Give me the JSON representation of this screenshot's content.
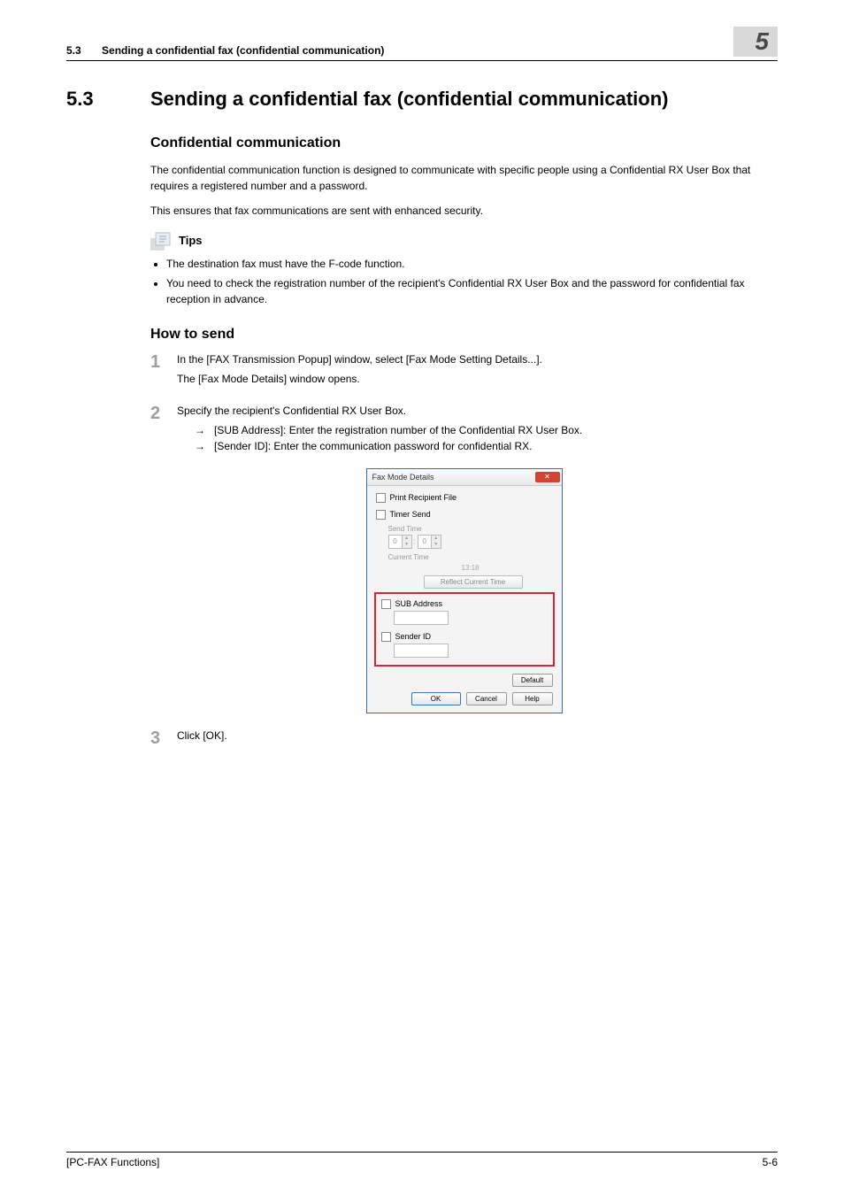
{
  "header": {
    "section_number": "5.3",
    "section_title_short": "Sending a confidential fax (confidential communication)",
    "chapter_number": "5"
  },
  "title": {
    "number": "5.3",
    "text": "Sending a confidential fax (confidential communication)"
  },
  "sub1": {
    "heading": "Confidential communication",
    "p1": "The confidential communication function is designed to communicate with specific people using a Confidential RX User Box that requires a registered number and a password.",
    "p2": "This ensures that fax communications are sent with enhanced security."
  },
  "tips": {
    "label": "Tips",
    "items": [
      "The destination fax must have the F-code function.",
      "You need to check the registration number of the recipient's Confidential RX User Box and the password for confidential fax reception in advance."
    ]
  },
  "sub2": {
    "heading": "How to send",
    "steps": {
      "s1": {
        "num": "1",
        "l1": "In the [FAX Transmission Popup] window, select [Fax Mode Setting Details...].",
        "l2": "The [Fax Mode Details] window opens."
      },
      "s2": {
        "num": "2",
        "l1": "Specify the recipient's Confidential RX User Box.",
        "sub": [
          "[SUB Address]: Enter the registration number of the Confidential RX User Box.",
          "[Sender ID]: Enter the communication password for confidential RX."
        ]
      },
      "s3": {
        "num": "3",
        "l1": "Click [OK]."
      }
    }
  },
  "dialog": {
    "title": "Fax Mode Details",
    "print_recipient": "Print Recipient File",
    "timer_send": "Timer Send",
    "send_time": "Send Time",
    "h": "0",
    "m": "0",
    "current_time_label": "Current Time",
    "current_time_val": "13:18",
    "reflect": "Reflect Current Time",
    "sub_address": "SUB Address",
    "sender_id": "Sender ID",
    "default": "Default",
    "ok": "OK",
    "cancel": "Cancel",
    "help": "Help"
  },
  "footer": {
    "left": "[PC-FAX Functions]",
    "right": "5-6"
  },
  "arrow": "→"
}
